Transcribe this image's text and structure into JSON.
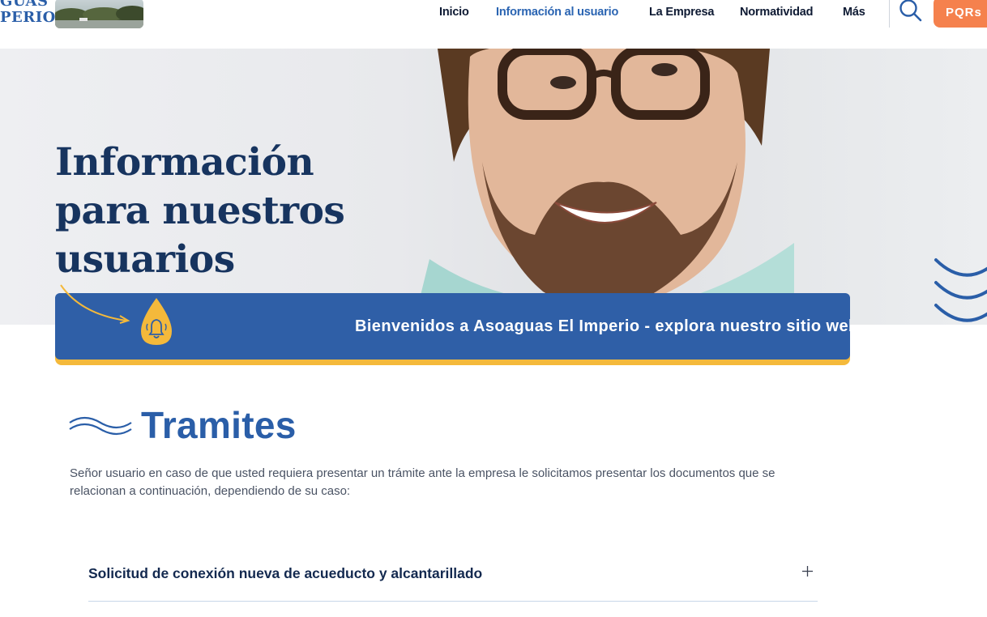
{
  "header": {
    "logo_lines": [
      "GUAS",
      "PERIO"
    ],
    "nav": [
      {
        "label": "Inicio",
        "active": false
      },
      {
        "label": "Información al usuario",
        "active": true
      },
      {
        "label": "La Empresa",
        "active": false
      },
      {
        "label": "Normatividad",
        "active": false
      },
      {
        "label": "Más",
        "active": false
      }
    ],
    "search_icon": "search-icon",
    "pqr_label": "PQRs"
  },
  "hero": {
    "title_line1": "Información",
    "title_line2": "para nuestros",
    "title_line3": "usuarios"
  },
  "banner": {
    "icon": "bell-drop-icon",
    "text": "Bienvenidos a Asoaguas El Imperio - explora nuestro sitio web"
  },
  "tramites": {
    "title": "Tramites",
    "description": "Señor usuario en caso de que usted requiera presentar un trámite ante la empresa le solicitamos presentar los documentos que se relacionan a continuación, dependiendo de su caso:",
    "items": [
      {
        "label": "Solicitud de conexión nueva de acueducto y alcantarillado"
      }
    ]
  },
  "colors": {
    "primary": "#2f5fa7",
    "accent": "#f4b93b",
    "pqr": "#f5814d",
    "title_dark": "#17345f",
    "highlight": "#b6d9f2"
  }
}
